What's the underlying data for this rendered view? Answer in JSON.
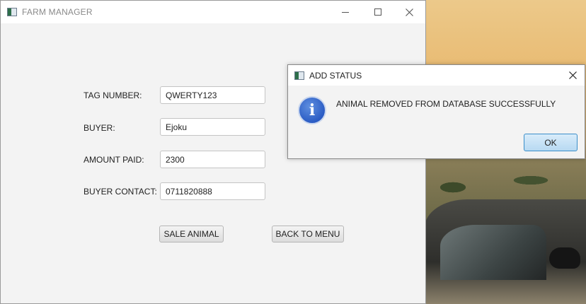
{
  "main_window": {
    "title": "FARM MANAGER",
    "form": {
      "tag_number": {
        "label": "TAG NUMBER:",
        "value": "QWERTY123"
      },
      "buyer": {
        "label": "BUYER:",
        "value": "Ejoku"
      },
      "amount_paid": {
        "label": "AMOUNT PAID:",
        "value": "2300"
      },
      "buyer_contact": {
        "label": "BUYER CONTACT:",
        "value": "0711820888"
      }
    },
    "buttons": {
      "sale_animal": "SALE ANIMAL",
      "back_to_menu": "BACK TO MENU"
    }
  },
  "dialog": {
    "title": "ADD STATUS",
    "icon": "info-icon",
    "message": "ANIMAL REMOVED FROM DATABASE SUCCESSFULLY",
    "ok_label": "OK"
  },
  "colors": {
    "window_bg": "#f3f3f3",
    "ok_button_accent": "#3a8ec9",
    "info_icon": "#2b5cc4"
  }
}
